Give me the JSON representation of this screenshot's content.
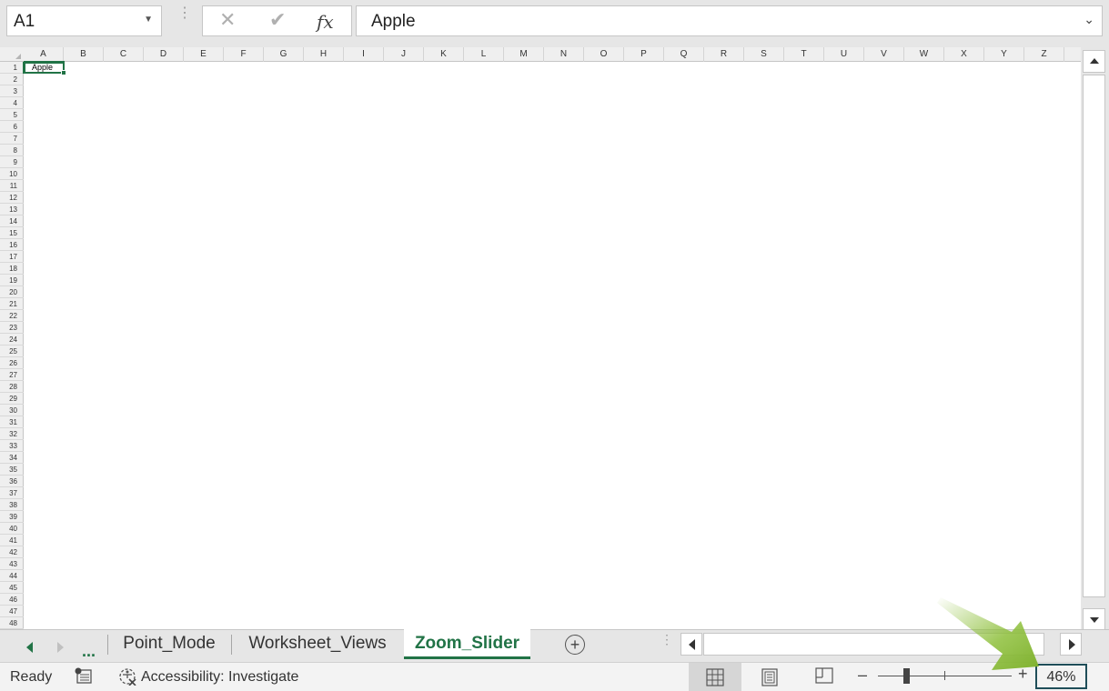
{
  "formula_bar": {
    "name_box": "A1",
    "cancel_icon": "✕",
    "enter_icon": "✔",
    "fx_label": "fx",
    "content": "Apple"
  },
  "sheet": {
    "columns": [
      "A",
      "B",
      "C",
      "D",
      "E",
      "F",
      "G",
      "H",
      "I",
      "J",
      "K",
      "L",
      "M",
      "N",
      "O",
      "P",
      "Q",
      "R",
      "S",
      "T",
      "U",
      "V",
      "W",
      "X",
      "Y",
      "Z"
    ],
    "rows": [
      "1",
      "2",
      "3",
      "4",
      "5",
      "6",
      "7",
      "8",
      "9",
      "10",
      "11",
      "12",
      "13",
      "14",
      "15",
      "16",
      "17",
      "18",
      "19",
      "20",
      "21",
      "22",
      "23",
      "24",
      "25",
      "26",
      "27",
      "28",
      "29",
      "30",
      "31",
      "32",
      "33",
      "34",
      "35",
      "36",
      "37",
      "38",
      "39",
      "40",
      "41",
      "42",
      "43",
      "44",
      "45",
      "46",
      "47",
      "48"
    ],
    "cell_a1": "Apple"
  },
  "tabs": {
    "ellipsis": "...",
    "items": [
      "Point_Mode",
      "Worksheet_Views",
      "Zoom_Slider"
    ],
    "active": "Zoom_Slider",
    "add_symbol": "+"
  },
  "status_bar": {
    "ready": "Ready",
    "accessibility": "Accessibility: Investigate",
    "zoom_minus": "–",
    "zoom_plus": "+",
    "zoom_level": "46%",
    "zoom_value": 46
  },
  "colors": {
    "accent": "#217346",
    "arrow": "#8dbf3a"
  }
}
